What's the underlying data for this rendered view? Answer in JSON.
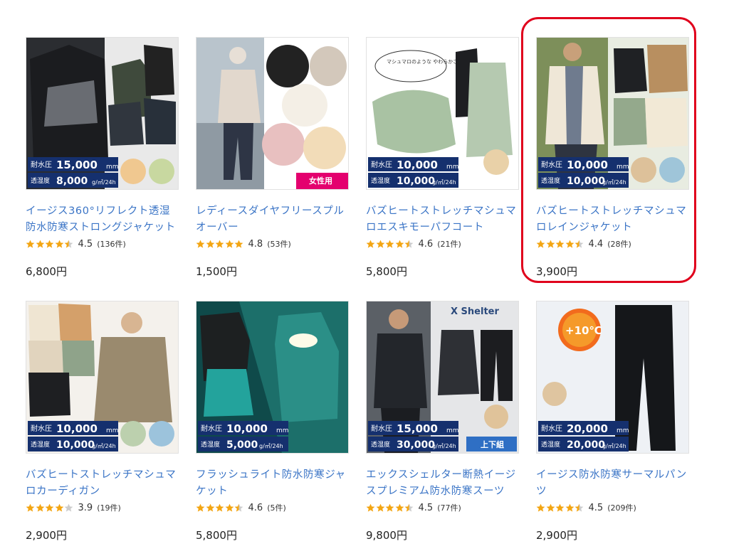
{
  "colors": {
    "link": "#3a74c6",
    "star": "#f3a512",
    "star_empty": "#cccccc",
    "highlight": "#e0001c",
    "spec_navy": "#15306e",
    "badge_pink": "#e4006e"
  },
  "products": [
    {
      "title": "イージス360°リフレクト透湿防水防寒ストロングジャケット",
      "rating": "4.5",
      "rating_value": 4.5,
      "count": "(136件)",
      "price": "6,800円",
      "image": {
        "spec1_label": "耐水圧",
        "spec1_value": "15,000",
        "spec1_unit": "mm",
        "spec2_label": "透湿度",
        "spec2_value": "8,000",
        "spec2_unit": "g/㎡/24h",
        "theme": "dark-jackets"
      }
    },
    {
      "title": "レディースダイヤフリースプルオーバー",
      "rating": "4.8",
      "rating_value": 4.8,
      "count": "(53件)",
      "price": "1,500円",
      "image": {
        "badge": "女性用",
        "theme": "fleece-women"
      }
    },
    {
      "title": "バズヒートストレッチマシュマロエスキモーパフコート",
      "rating": "4.6",
      "rating_value": 4.6,
      "count": "(21件)",
      "price": "5,800円",
      "image": {
        "bubble": "マシュマロのような やわらかさ",
        "spec1_label": "耐水圧",
        "spec1_value": "10,000",
        "spec1_unit": "mm",
        "spec2_label": "透湿度",
        "spec2_value": "10,000",
        "spec2_unit": "g/㎡/24h",
        "theme": "puff-coat"
      }
    },
    {
      "title": "バズヒートストレッチマシュマロレインジャケット",
      "rating": "4.4",
      "rating_value": 4.4,
      "count": "(28件)",
      "price": "3,900円",
      "image": {
        "spec1_label": "耐水圧",
        "spec1_value": "10,000",
        "spec1_unit": "mm",
        "spec2_label": "透湿度",
        "spec2_value": "10,000",
        "spec2_unit": "g/㎡/24h",
        "theme": "rain-jacket"
      }
    },
    {
      "title": "バズヒートストレッチマシュマロカーディガン",
      "rating": "3.9",
      "rating_value": 3.9,
      "count": "(19件)",
      "price": "2,900円",
      "image": {
        "spec1_label": "耐水圧",
        "spec1_value": "10,000",
        "spec1_unit": "mm",
        "spec2_label": "透湿度",
        "spec2_value": "10,000",
        "spec2_unit": "g/㎡/24h",
        "theme": "cardigan"
      }
    },
    {
      "title": "フラッシュライト防水防寒ジャケット",
      "rating": "4.6",
      "rating_value": 4.6,
      "count": "(5件)",
      "price": "5,800円",
      "image": {
        "spec1_label": "耐水圧",
        "spec1_value": "10,000",
        "spec1_unit": "mm",
        "spec2_label": "透湿度",
        "spec2_value": "5,000",
        "spec2_unit": "g/㎡/24h",
        "theme": "flashlight"
      }
    },
    {
      "title": "エックスシェルター断熱イージスプレミアム防水防寒スーツ",
      "rating": "4.5",
      "rating_value": 4.5,
      "count": "(77件)",
      "price": "9,800円",
      "image": {
        "logo": "X Shelter",
        "badge": "上下組",
        "spec1_label": "耐水圧",
        "spec1_value": "15,000",
        "spec1_unit": "mm",
        "spec2_label": "透湿度",
        "spec2_value": "30,000",
        "spec2_unit": "g/㎡/24h",
        "theme": "suit"
      }
    },
    {
      "title": "イージス防水防寒サーマルパンツ",
      "rating": "4.5",
      "rating_value": 4.5,
      "count": "(209件)",
      "price": "2,900円",
      "image": {
        "temp": "+10℃",
        "spec1_label": "耐水圧",
        "spec1_value": "20,000",
        "spec1_unit": "mm",
        "spec2_label": "透湿度",
        "spec2_value": "20,000",
        "spec2_unit": "g/㎡/24h",
        "theme": "pants"
      }
    }
  ]
}
